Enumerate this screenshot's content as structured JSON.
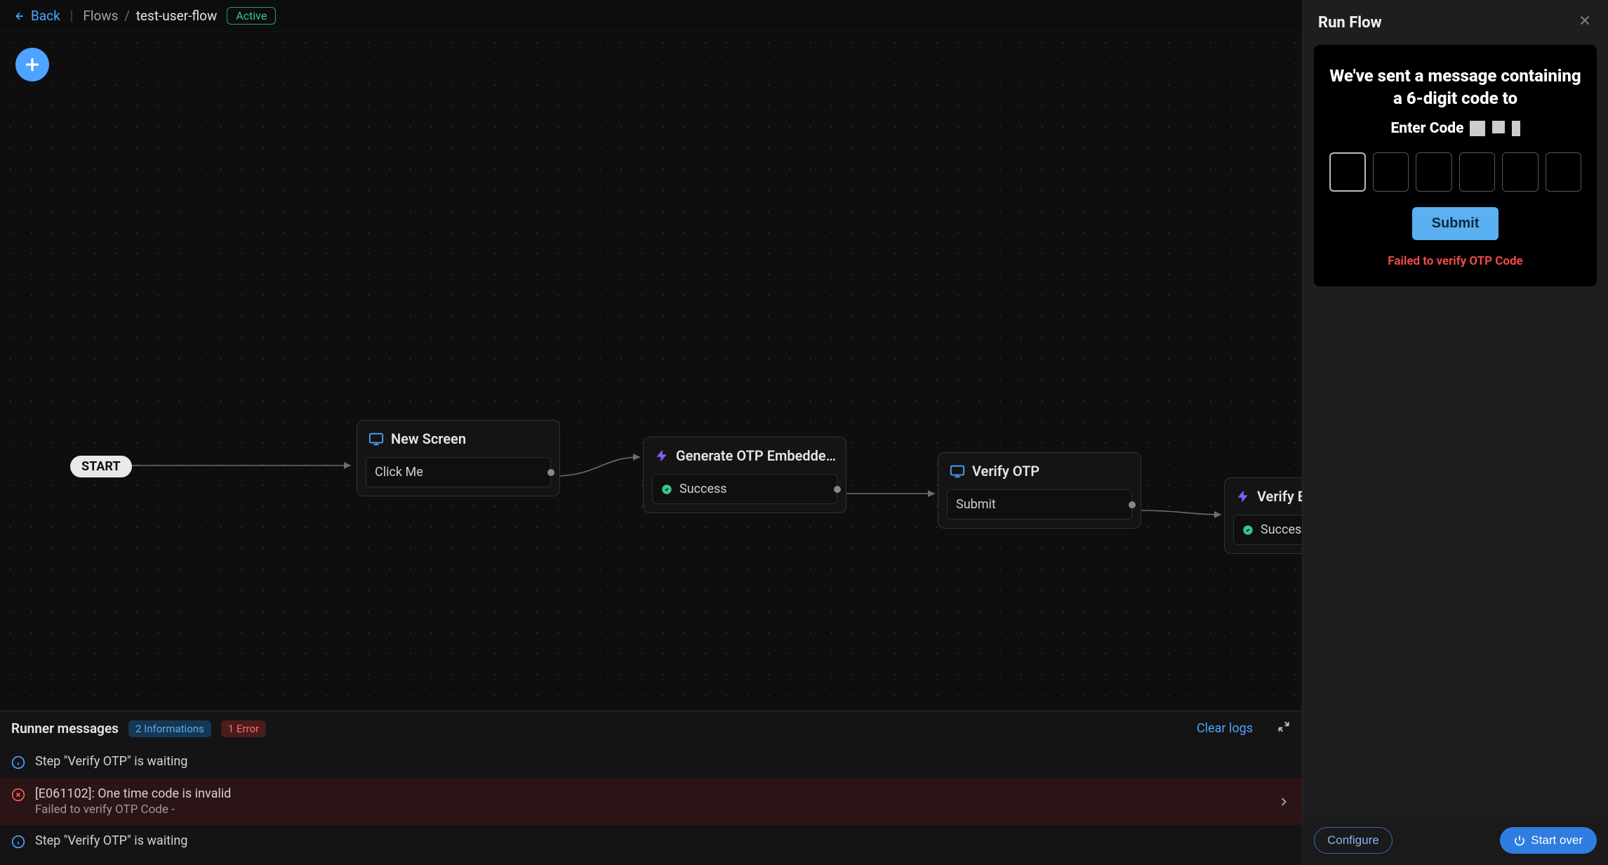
{
  "topbar": {
    "back_label": "Back",
    "crumb_root": "Flows",
    "crumb_current": "test-user-flow",
    "status": "Active"
  },
  "canvas": {
    "start_label": "START",
    "nodes": [
      {
        "id": "new-screen",
        "title": "New Screen",
        "icon": "screen",
        "outputs": [
          {
            "label": "Click Me",
            "status": null
          }
        ]
      },
      {
        "id": "generate-otp",
        "title": "Generate OTP Embedded Code f...",
        "icon": "bolt",
        "outputs": [
          {
            "label": "Success",
            "status": "success"
          }
        ]
      },
      {
        "id": "verify-otp",
        "title": "Verify OTP",
        "icon": "screen",
        "outputs": [
          {
            "label": "Submit",
            "status": null
          }
        ]
      },
      {
        "id": "verify-embedded",
        "title": "Verify Embe",
        "icon": "bolt",
        "outputs": [
          {
            "label": "Successful au",
            "status": "success"
          }
        ]
      }
    ]
  },
  "messages": {
    "title": "Runner messages",
    "info_badge": "2 Informations",
    "error_badge": "1 Error",
    "clear_label": "Clear logs",
    "rows": [
      {
        "type": "info",
        "text": "Step \"Verify OTP\" is waiting"
      },
      {
        "type": "error",
        "text": "[E061102]: One time code is invalid",
        "subtext": "Failed to verify OTP Code -"
      },
      {
        "type": "info",
        "text": "Step \"Verify OTP\" is waiting"
      }
    ]
  },
  "side": {
    "title": "Run Flow",
    "preview": {
      "heading": "We've sent a message containing a 6-digit code to",
      "enter_label": "Enter Code",
      "submit_label": "Submit",
      "error_text": "Failed to verify OTP Code"
    },
    "footer": {
      "configure_label": "Configure",
      "startover_label": "Start over"
    }
  }
}
